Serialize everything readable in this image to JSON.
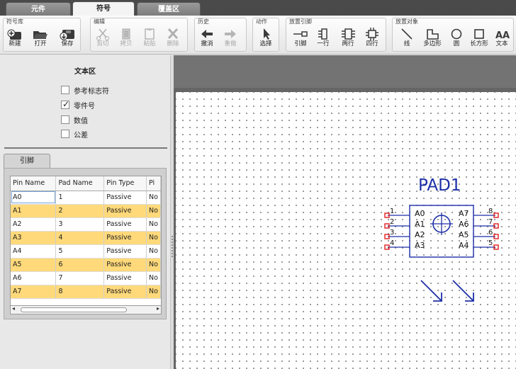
{
  "tabs": [
    {
      "label": "元件"
    },
    {
      "label": "符号"
    },
    {
      "label": "覆盖区"
    }
  ],
  "ribbon": {
    "groups": [
      {
        "title": "符号库",
        "buttons": [
          {
            "label": "新建"
          },
          {
            "label": "打开"
          },
          {
            "label": "保存"
          }
        ]
      },
      {
        "title": "编辑",
        "buttons": [
          {
            "label": "剪切"
          },
          {
            "label": "拷贝"
          },
          {
            "label": "粘贴"
          },
          {
            "label": "删除"
          }
        ]
      },
      {
        "title": "历史",
        "buttons": [
          {
            "label": "撤消"
          },
          {
            "label": "重做"
          }
        ]
      },
      {
        "title": "动作",
        "buttons": [
          {
            "label": "选择"
          }
        ]
      },
      {
        "title": "放置引脚",
        "buttons": [
          {
            "label": "引脚"
          },
          {
            "label": "一行"
          },
          {
            "label": "两行"
          },
          {
            "label": "四行"
          }
        ]
      },
      {
        "title": "放置对象",
        "buttons": [
          {
            "label": "线"
          },
          {
            "label": "多边形"
          },
          {
            "label": "圆"
          },
          {
            "label": "长方形"
          },
          {
            "label": "文本"
          }
        ]
      }
    ],
    "icons": {
      "new": "new-icon",
      "open": "folder-open-icon",
      "save": "save-icon",
      "cut": "scissors-icon",
      "copy": "copy-icon",
      "paste": "paste-icon",
      "delete": "delete-x-icon",
      "undo": "arrow-left-icon",
      "redo": "arrow-right-icon",
      "select": "cursor-icon",
      "pin": "pin-icon",
      "one_row": "pin-row-icon",
      "two_row": "two-row-icon",
      "four_row": "four-row-icon",
      "line": "line-icon",
      "polygon": "polygon-icon",
      "circle": "circle-icon",
      "rect": "rectangle-icon",
      "text": "text-icon"
    }
  },
  "text_area": {
    "title": "文本区",
    "options": [
      {
        "label": "参考标志符",
        "checked": false
      },
      {
        "label": "零件号",
        "checked": true
      },
      {
        "label": "数值",
        "checked": false
      },
      {
        "label": "公差",
        "checked": false
      }
    ]
  },
  "pins_tab": {
    "label": "引脚"
  },
  "pin_table": {
    "columns": [
      "Pin Name",
      "Pad Name",
      "Pin Type",
      "Pi"
    ],
    "rows": [
      [
        "A0",
        "1",
        "Passive",
        "No"
      ],
      [
        "A1",
        "2",
        "Passive",
        "No"
      ],
      [
        "A2",
        "3",
        "Passive",
        "No"
      ],
      [
        "A3",
        "4",
        "Passive",
        "No"
      ],
      [
        "A4",
        "5",
        "Passive",
        "No"
      ],
      [
        "A5",
        "6",
        "Passive",
        "No"
      ],
      [
        "A6",
        "7",
        "Passive",
        "No"
      ],
      [
        "A7",
        "8",
        "Passive",
        "No"
      ]
    ],
    "highlight_color": "#ffd97a"
  },
  "symbol": {
    "name": "PAD1",
    "left_pins": [
      {
        "num": "1",
        "name": "A0"
      },
      {
        "num": "2",
        "name": "A1"
      },
      {
        "num": "3",
        "name": "A2"
      },
      {
        "num": "4",
        "name": "A3"
      }
    ],
    "right_pins": [
      {
        "num": "8",
        "name": "A7"
      },
      {
        "num": "7",
        "name": "A6"
      },
      {
        "num": "6",
        "name": "A5"
      },
      {
        "num": "5",
        "name": "A4"
      }
    ],
    "color": "#1c2fa8",
    "pin_end_color": "#e02020"
  }
}
